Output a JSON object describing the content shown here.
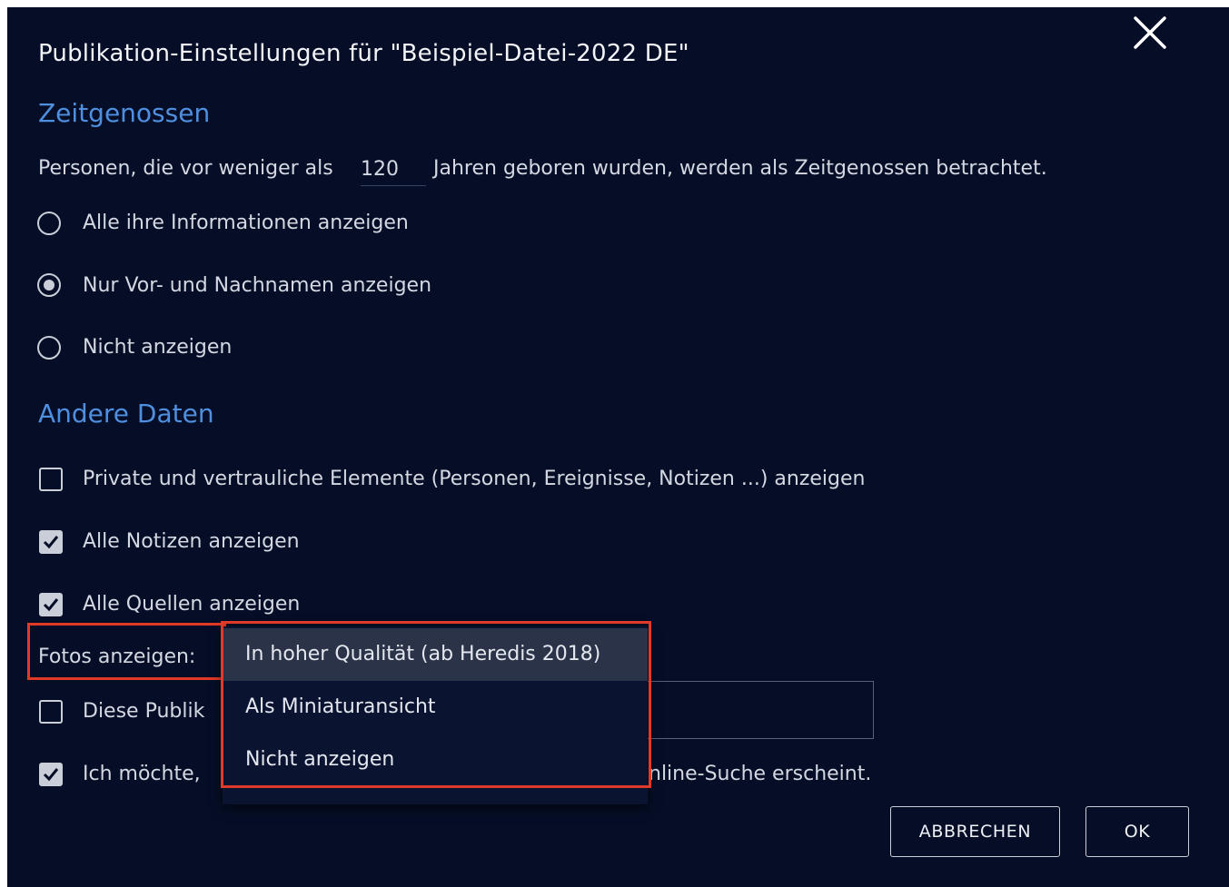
{
  "dialog": {
    "title": "Publikation-Einstellungen für \"Beispiel-Datei-2022 DE\"",
    "close_icon": "close-icon"
  },
  "contemporaries": {
    "heading": "Zeitgenossen",
    "sentence_before": "Personen, die vor weniger als",
    "years_value": "120",
    "sentence_after": "Jahren geboren wurden, werden als Zeitgenossen betrachtet.",
    "options": [
      {
        "label": "Alle ihre Informationen anzeigen",
        "checked": false
      },
      {
        "label": "Nur Vor- und Nachnamen anzeigen",
        "checked": true
      },
      {
        "label": "Nicht anzeigen",
        "checked": false
      }
    ]
  },
  "other_data": {
    "heading": "Andere Daten",
    "private_label": "Private und vertrauliche Elemente (Personen, Ereignisse, Notizen ...) anzeigen",
    "private_checked": false,
    "notes_label": "Alle Notizen anzeigen",
    "notes_checked": true,
    "sources_label": "Alle Quellen anzeigen",
    "sources_checked": true,
    "photos_label": "Fotos anzeigen:",
    "publication_label_visible": "Diese Publik",
    "publication_checked": false,
    "search_label_start": "Ich möchte,",
    "search_label_end": "nline-Suche erscheint.",
    "search_checked": true
  },
  "photos_dropdown": {
    "options": [
      {
        "label": "In hoher Qualität (ab Heredis 2018)",
        "selected": true
      },
      {
        "label": "Als Miniaturansicht",
        "selected": false
      },
      {
        "label": "Nicht anzeigen",
        "selected": false
      }
    ]
  },
  "buttons": {
    "cancel": "ABBRECHEN",
    "ok": "OK"
  },
  "colors": {
    "background": "#050e26",
    "accent": "#4f8fe0",
    "highlight": "#e03a28"
  }
}
